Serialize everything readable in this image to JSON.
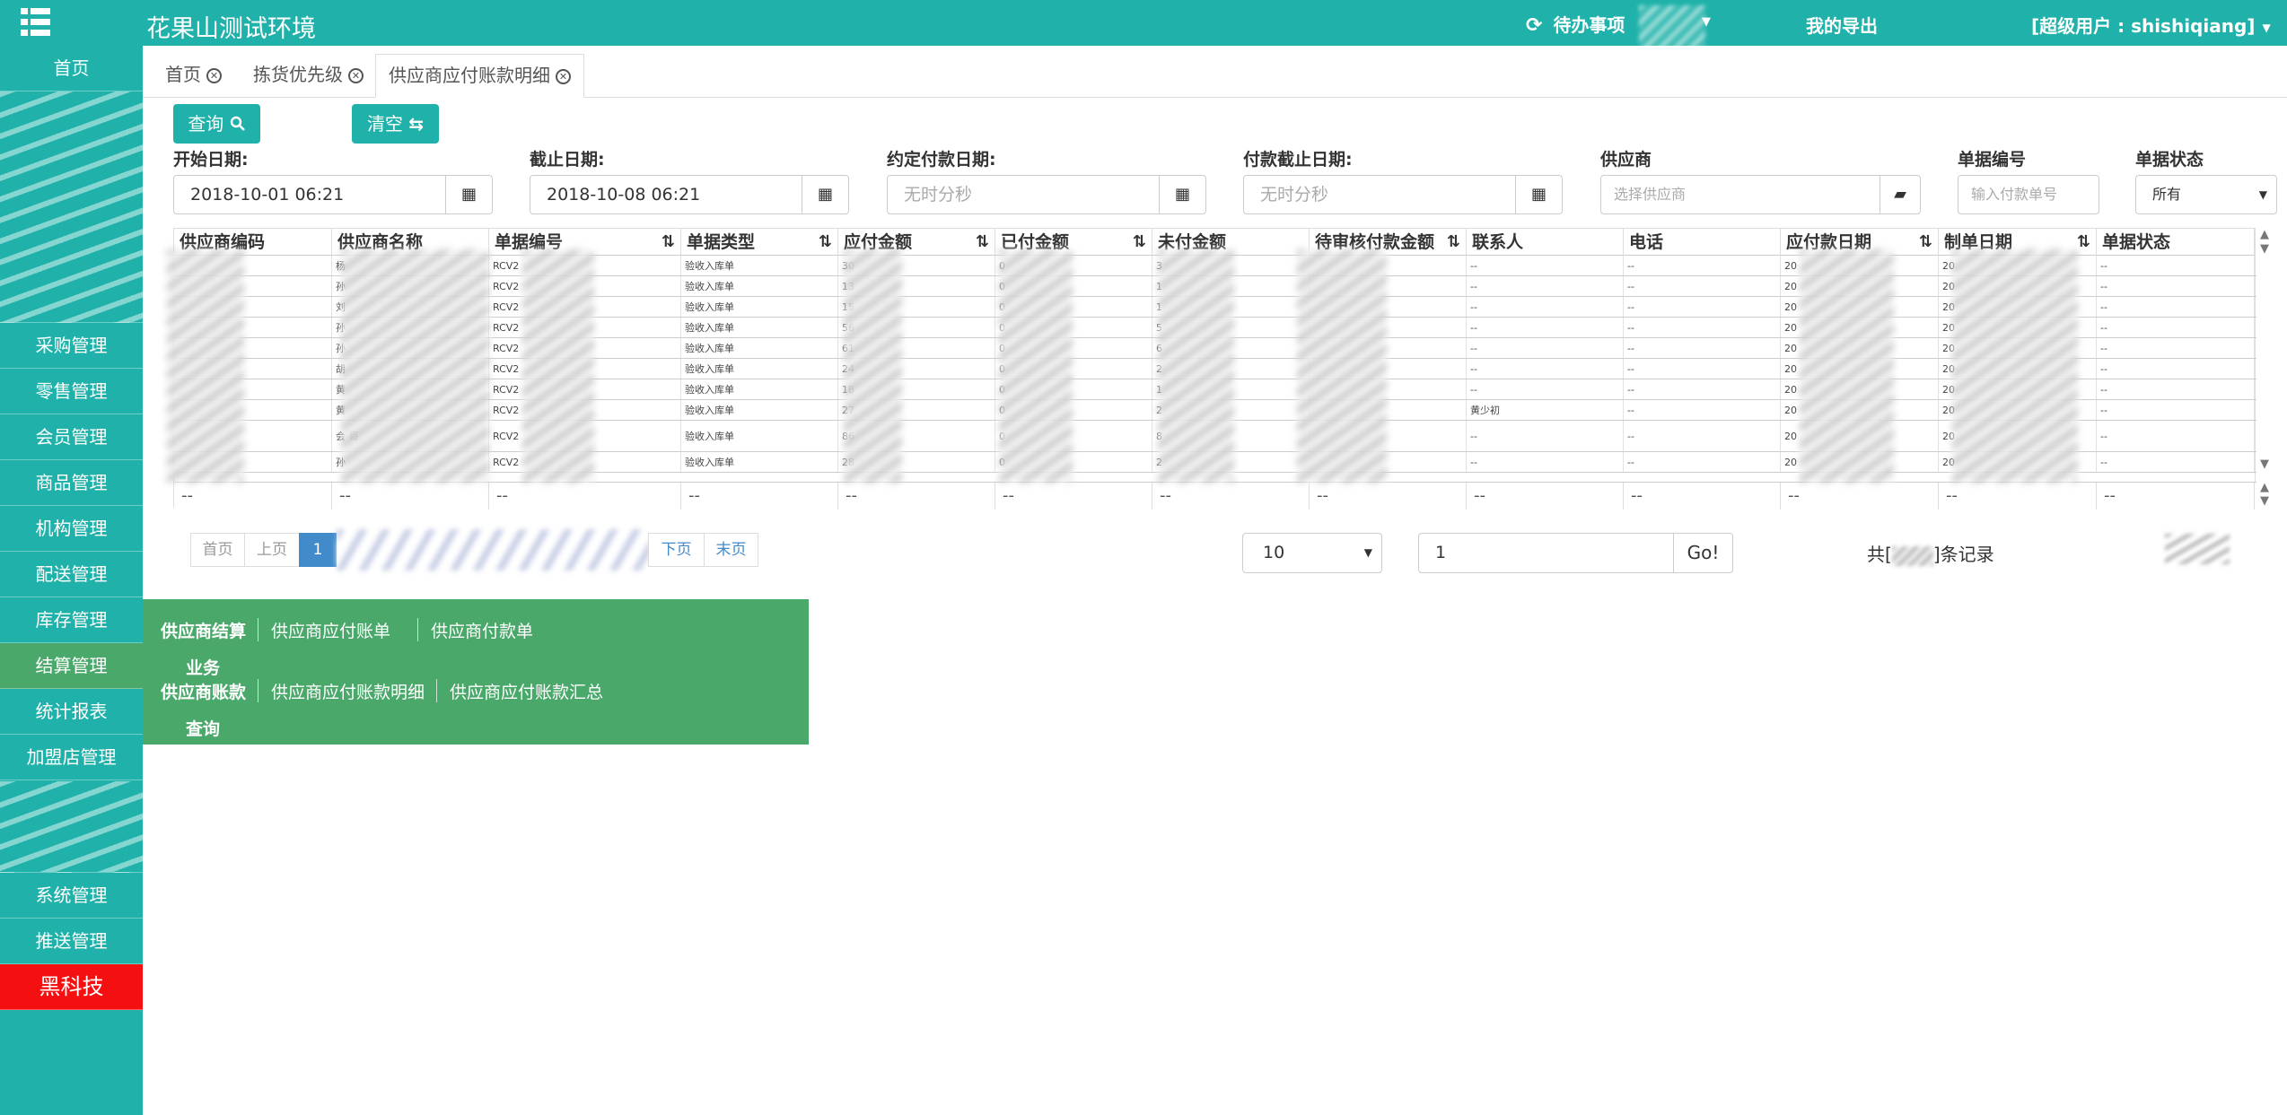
{
  "app": {
    "title": "花果山测试环境"
  },
  "topbar": {
    "todo_label": "待办事项",
    "export_label": "我的导出",
    "user_label": "[超级用户 : shishiqiang]"
  },
  "sidebar": {
    "items": {
      "home": "首页",
      "purchase": "采购管理",
      "retail": "零售管理",
      "member": "会员管理",
      "goods": "商品管理",
      "org": "机构管理",
      "delivery": "配送管理",
      "stock": "库存管理",
      "settle": "结算管理",
      "report": "统计报表",
      "franchise": "加盟店管理",
      "system": "系统管理",
      "push": "推送管理",
      "blacktech": "黑科技"
    }
  },
  "tabs": [
    {
      "label": "首页"
    },
    {
      "label": "拣货优先级"
    },
    {
      "label": "供应商应付账款明细"
    }
  ],
  "toolbar": {
    "query_label": "查询",
    "clear_label": "清空"
  },
  "filters": {
    "start_date": {
      "label": "开始日期:",
      "value": "2018-10-01 06:21"
    },
    "end_date": {
      "label": "截止日期:",
      "value": "2018-10-08 06:21"
    },
    "agreed_pay_date": {
      "label": "约定付款日期:",
      "placeholder": "无时分秒"
    },
    "pay_deadline": {
      "label": "付款截止日期:",
      "placeholder": "无时分秒"
    },
    "supplier": {
      "label": "供应商",
      "placeholder": "选择供应商"
    },
    "doc_no": {
      "label": "单据编号",
      "placeholder": "输入付款单号"
    },
    "doc_status": {
      "label": "单据状态",
      "value": "所有"
    }
  },
  "table": {
    "headers": [
      "供应商编码",
      "供应商名称",
      "单据编号",
      "单据类型",
      "应付金额",
      "已付金额",
      "未付金额",
      "待审核付款金额",
      "联系人",
      "电话",
      "应付款日期",
      "制单日期",
      "单据状态"
    ],
    "rows": [
      [
        "",
        "杨",
        "RCV2",
        "验收入库单",
        "30",
        "0",
        "3",
        "",
        "--",
        "--",
        "20",
        "20",
        "--"
      ],
      [
        "",
        "孙",
        "RCV2",
        "验收入库单",
        "13",
        "0",
        "1",
        "",
        "--",
        "--",
        "20",
        "20",
        "--"
      ],
      [
        "",
        "刘",
        "RCV2",
        "验收入库单",
        "15",
        "0",
        "1",
        "",
        "--",
        "--",
        "20",
        "20",
        "--"
      ],
      [
        "",
        "孙",
        "RCV2",
        "验收入库单",
        "56",
        "0",
        "5",
        "",
        "--",
        "--",
        "20",
        "20",
        "--"
      ],
      [
        "",
        "孙",
        "RCV2",
        "验收入库单",
        "61",
        "0",
        "6",
        "",
        "--",
        "--",
        "20",
        "20",
        "--"
      ],
      [
        "",
        "胡",
        "RCV2",
        "验收入库单",
        "24",
        "0",
        "2",
        "",
        "--",
        "--",
        "20",
        "20",
        "--"
      ],
      [
        "",
        "黄",
        "RCV2",
        "验收入库单",
        "18",
        "0",
        "1",
        "",
        "--",
        "--",
        "20",
        "20",
        "--"
      ],
      [
        "",
        "黄",
        "RCV2",
        "验收入库单",
        "27",
        "0",
        "2",
        "",
        "黄少初",
        "--",
        "20",
        "20",
        "--"
      ],
      [
        "",
        "会 哥",
        "RCV2",
        "验收入库单",
        "86",
        "0",
        "8",
        "",
        "--",
        "--",
        "20",
        "20",
        "--"
      ],
      [
        "",
        "孙",
        "RCV2",
        "验收入库单",
        "28",
        "0",
        "2",
        "",
        "--",
        "--",
        "20",
        "20",
        "--"
      ]
    ],
    "footer": [
      "--",
      "--",
      "--",
      "--",
      "--",
      "--",
      "--",
      "--",
      "--",
      "--",
      "--",
      "--",
      "--"
    ]
  },
  "pagination": {
    "first": "首页",
    "prev": "上页",
    "current": "1",
    "next": "下页",
    "last": "末页",
    "page_size": "10",
    "goto_value": "1",
    "go_label": "Go!",
    "total_prefix": "共[",
    "total_suffix": "]条记录"
  },
  "settle_menu": {
    "group1_title_line1": "供应商结算",
    "group1_title_line2": "业务",
    "group1_links": [
      "供应商应付账单",
      "供应商付款单"
    ],
    "group2_title_line1": "供应商账款",
    "group2_title_line2": "查询",
    "group2_links": [
      "供应商应付账款明细",
      "供应商应付账款汇总"
    ]
  },
  "colors": {
    "primary": "#20b2aa",
    "active_menu": "#4aa86a",
    "danger": "#f40f10",
    "link": "#428bca"
  }
}
